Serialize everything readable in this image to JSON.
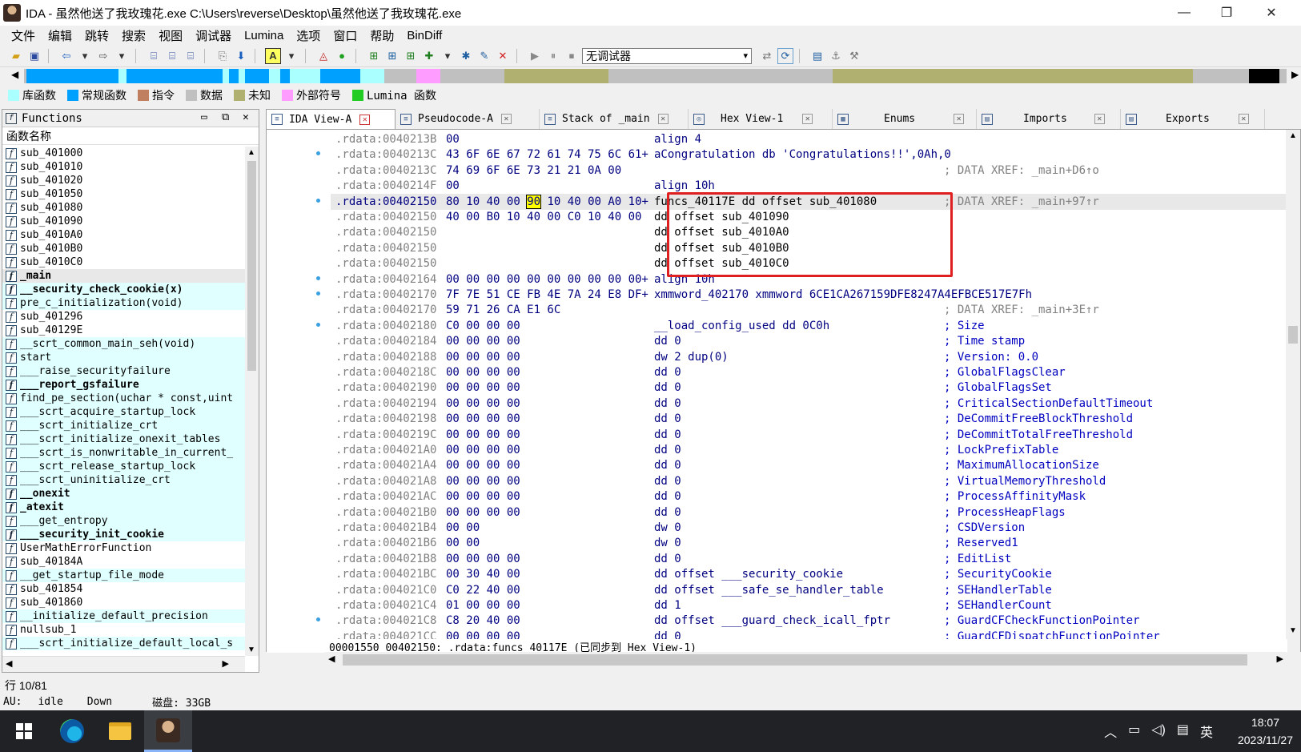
{
  "window": {
    "title": "IDA - 虽然他送了我玫瑰花.exe C:\\Users\\reverse\\Desktop\\虽然他送了我玫瑰花.exe",
    "minimize": "—",
    "maximize": "❐",
    "close": "✕"
  },
  "menu": [
    "文件",
    "编辑",
    "跳转",
    "搜索",
    "视图",
    "调试器",
    "Lumina",
    "选项",
    "窗口",
    "帮助",
    "BinDiff"
  ],
  "toolbar": {
    "debugger_value": "无调试器"
  },
  "legend": [
    {
      "label": "库函数",
      "color": "#aaffff"
    },
    {
      "label": "常规函数",
      "color": "#00a0ff"
    },
    {
      "label": "指令",
      "color": "#c08060"
    },
    {
      "label": "数据",
      "color": "#c0c0c0"
    },
    {
      "label": "未知",
      "color": "#b0b070"
    },
    {
      "label": "外部符号",
      "color": "#ff9cff"
    },
    {
      "label": "Lumina 函数",
      "color": "#22cc22"
    }
  ],
  "functions_pane": {
    "title": "Functions",
    "column": "函数名称",
    "status": "行 10/81",
    "items": [
      {
        "name": "sub_401000",
        "kind": "regular"
      },
      {
        "name": "sub_401010",
        "kind": "regular"
      },
      {
        "name": "sub_401020",
        "kind": "regular"
      },
      {
        "name": "sub_401050",
        "kind": "regular"
      },
      {
        "name": "sub_401080",
        "kind": "regular"
      },
      {
        "name": "sub_401090",
        "kind": "regular"
      },
      {
        "name": "sub_4010A0",
        "kind": "regular"
      },
      {
        "name": "sub_4010B0",
        "kind": "regular"
      },
      {
        "name": "sub_4010C0",
        "kind": "regular"
      },
      {
        "name": "_main",
        "kind": "selected"
      },
      {
        "name": "__security_check_cookie(x)",
        "kind": "lib-bold"
      },
      {
        "name": "pre_c_initialization(void)",
        "kind": "lib"
      },
      {
        "name": "sub_401296",
        "kind": "regular"
      },
      {
        "name": "sub_40129E",
        "kind": "regular"
      },
      {
        "name": "__scrt_common_main_seh(void)",
        "kind": "lib"
      },
      {
        "name": "start",
        "kind": "lib"
      },
      {
        "name": "___raise_securityfailure",
        "kind": "lib"
      },
      {
        "name": "___report_gsfailure",
        "kind": "lib-bold"
      },
      {
        "name": "find_pe_section(uchar * const,uint",
        "kind": "lib"
      },
      {
        "name": "___scrt_acquire_startup_lock",
        "kind": "lib"
      },
      {
        "name": "___scrt_initialize_crt",
        "kind": "lib"
      },
      {
        "name": "___scrt_initialize_onexit_tables",
        "kind": "lib"
      },
      {
        "name": "___scrt_is_nonwritable_in_current_",
        "kind": "lib"
      },
      {
        "name": "___scrt_release_startup_lock",
        "kind": "lib"
      },
      {
        "name": "___scrt_uninitialize_crt",
        "kind": "lib"
      },
      {
        "name": "__onexit",
        "kind": "lib-bold"
      },
      {
        "name": "_atexit",
        "kind": "lib-bold"
      },
      {
        "name": "___get_entropy",
        "kind": "lib"
      },
      {
        "name": "___security_init_cookie",
        "kind": "lib-bold"
      },
      {
        "name": "UserMathErrorFunction",
        "kind": "regular"
      },
      {
        "name": "sub_40184A",
        "kind": "regular"
      },
      {
        "name": "__get_startup_file_mode",
        "kind": "lib"
      },
      {
        "name": "sub_401854",
        "kind": "regular"
      },
      {
        "name": "sub_401860",
        "kind": "regular"
      },
      {
        "name": "__initialize_default_precision",
        "kind": "lib"
      },
      {
        "name": "nullsub_1",
        "kind": "regular"
      },
      {
        "name": "___scrt_initialize_default_local_s",
        "kind": "lib"
      }
    ]
  },
  "tabs": [
    {
      "label": "IDA View-A",
      "active": true
    },
    {
      "label": "Pseudocode-A",
      "active": false
    },
    {
      "label": "Stack of _main",
      "active": false
    },
    {
      "label": "Hex View-1",
      "active": false
    },
    {
      "label": "Enums",
      "active": false
    },
    {
      "label": "Imports",
      "active": false
    },
    {
      "label": "Exports",
      "active": false
    }
  ],
  "disasm": {
    "lines": [
      {
        "addr": ".rdata:0040213B",
        "bytes": "00",
        "instr": "align 4",
        "cmt": ""
      },
      {
        "addr": ".rdata:0040213C",
        "bytes": "43 6F 6E 67 72 61 74 75 6C 61+",
        "instr": "aCongratulation db 'Congratulations!!',0Ah,0",
        "cmt": ""
      },
      {
        "addr": ".rdata:0040213C",
        "bytes": "74 69 6F 6E 73 21 21 0A 00",
        "instr": "",
        "cmt": "; DATA XREF: _main+D6↑o"
      },
      {
        "addr": ".rdata:0040214F",
        "bytes": "00",
        "instr": "align 10h",
        "cmt": ""
      },
      {
        "addr": ".rdata:00402150",
        "bytes": "80 10 40 00 90 10 40 00 A0 10+",
        "instr": "funcs_40117E dd offset sub_401080",
        "cmt": "; DATA XREF: _main+97↑r",
        "current": true
      },
      {
        "addr": ".rdata:00402150",
        "bytes": "40 00 B0 10 40 00 C0 10 40 00",
        "instr": "dd offset sub_401090",
        "cmt": ""
      },
      {
        "addr": ".rdata:00402150",
        "bytes": "",
        "instr": "dd offset sub_4010A0",
        "cmt": ""
      },
      {
        "addr": ".rdata:00402150",
        "bytes": "",
        "instr": "dd offset sub_4010B0",
        "cmt": ""
      },
      {
        "addr": ".rdata:00402150",
        "bytes": "",
        "instr": "dd offset sub_4010C0",
        "cmt": ""
      },
      {
        "addr": ".rdata:00402164",
        "bytes": "00 00 00 00 00 00 00 00 00 00+",
        "instr": "align 10h",
        "cmt": ""
      },
      {
        "addr": ".rdata:00402170",
        "bytes": "7F 7E 51 CE FB 4E 7A 24 E8 DF+",
        "instr": "xmmword_402170 xmmword 6CE1CA267159DFE8247A4EFBCE517E7Fh",
        "cmt": ""
      },
      {
        "addr": ".rdata:00402170",
        "bytes": "59 71 26 CA E1 6C",
        "instr": "",
        "cmt": "; DATA XREF: _main+3E↑r"
      },
      {
        "addr": ".rdata:00402180",
        "bytes": "C0 00 00 00",
        "instr": "__load_config_used dd 0C0h",
        "cmt": "; Size"
      },
      {
        "addr": ".rdata:00402184",
        "bytes": "00 00 00 00",
        "instr": "dd 0",
        "cmt": "; Time stamp"
      },
      {
        "addr": ".rdata:00402188",
        "bytes": "00 00 00 00",
        "instr": "dw 2 dup(0)",
        "cmt": "; Version: 0.0"
      },
      {
        "addr": ".rdata:0040218C",
        "bytes": "00 00 00 00",
        "instr": "dd 0",
        "cmt": "; GlobalFlagsClear"
      },
      {
        "addr": ".rdata:00402190",
        "bytes": "00 00 00 00",
        "instr": "dd 0",
        "cmt": "; GlobalFlagsSet"
      },
      {
        "addr": ".rdata:00402194",
        "bytes": "00 00 00 00",
        "instr": "dd 0",
        "cmt": "; CriticalSectionDefaultTimeout"
      },
      {
        "addr": ".rdata:00402198",
        "bytes": "00 00 00 00",
        "instr": "dd 0",
        "cmt": "; DeCommitFreeBlockThreshold"
      },
      {
        "addr": ".rdata:0040219C",
        "bytes": "00 00 00 00",
        "instr": "dd 0",
        "cmt": "; DeCommitTotalFreeThreshold"
      },
      {
        "addr": ".rdata:004021A0",
        "bytes": "00 00 00 00",
        "instr": "dd 0",
        "cmt": "; LockPrefixTable"
      },
      {
        "addr": ".rdata:004021A4",
        "bytes": "00 00 00 00",
        "instr": "dd 0",
        "cmt": "; MaximumAllocationSize"
      },
      {
        "addr": ".rdata:004021A8",
        "bytes": "00 00 00 00",
        "instr": "dd 0",
        "cmt": "; VirtualMemoryThreshold"
      },
      {
        "addr": ".rdata:004021AC",
        "bytes": "00 00 00 00",
        "instr": "dd 0",
        "cmt": "; ProcessAffinityMask"
      },
      {
        "addr": ".rdata:004021B0",
        "bytes": "00 00 00 00",
        "instr": "dd 0",
        "cmt": "; ProcessHeapFlags"
      },
      {
        "addr": ".rdata:004021B4",
        "bytes": "00 00",
        "instr": "dw 0",
        "cmt": "; CSDVersion"
      },
      {
        "addr": ".rdata:004021B6",
        "bytes": "00 00",
        "instr": "dw 0",
        "cmt": "; Reserved1"
      },
      {
        "addr": ".rdata:004021B8",
        "bytes": "00 00 00 00",
        "instr": "dd 0",
        "cmt": "; EditList"
      },
      {
        "addr": ".rdata:004021BC",
        "bytes": "00 30 40 00",
        "instr": "dd offset ___security_cookie",
        "cmt": "; SecurityCookie"
      },
      {
        "addr": ".rdata:004021C0",
        "bytes": "C0 22 40 00",
        "instr": "dd offset ___safe_se_handler_table",
        "cmt": "; SEHandlerTable"
      },
      {
        "addr": ".rdata:004021C4",
        "bytes": "01 00 00 00",
        "instr": "dd 1",
        "cmt": "; SEHandlerCount"
      },
      {
        "addr": ".rdata:004021C8",
        "bytes": "C8 20 40 00",
        "instr": "dd offset ___guard_check_icall_fptr",
        "cmt": "; GuardCFCheckFunctionPointer"
      },
      {
        "addr": ".rdata:004021CC",
        "bytes": "00 00 00 00",
        "instr": "dd 0",
        "cmt": "; GuardCFDispatchFunctionPointer"
      }
    ],
    "status": "00001550 00402150: .rdata:funcs_40117E (已同步到 Hex View-1)"
  },
  "status_bar": {
    "au": "AU:",
    "state": "idle",
    "dir": "Down",
    "disk": "磁盘: 33GB"
  },
  "taskbar": {
    "time": "18:07",
    "date": "2023/11/27",
    "ime": "英"
  }
}
